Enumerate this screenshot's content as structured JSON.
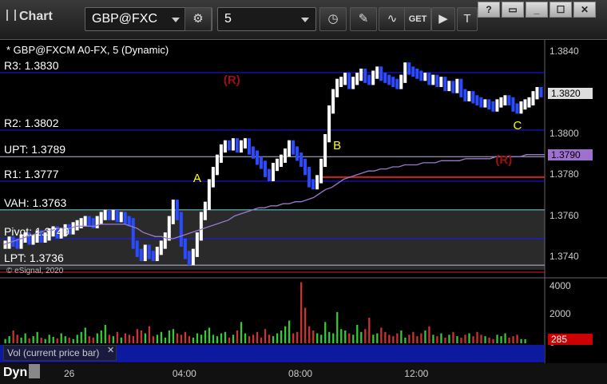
{
  "toolbar": {
    "title": "Chart",
    "symbol": "GBP@FXC",
    "interval": "5",
    "window_controls": [
      "?",
      "▭",
      "_",
      "☐",
      "✕"
    ]
  },
  "legend": "* GBP@FXCM A0-FX, 5 (Dynamic)",
  "levels": [
    {
      "label": "R3: 1.3830",
      "value": 1.383,
      "color": "#1a1aff"
    },
    {
      "label": "R2: 1.3802",
      "value": 1.3802,
      "color": "#1a1aff"
    },
    {
      "label": "UPT: 1.3789",
      "value": 1.3789,
      "color": "#bbbbdd"
    },
    {
      "label": "R1: 1.3777",
      "value": 1.3777,
      "color": "#1a1aff"
    },
    {
      "label": "VAH: 1.3763",
      "value": 1.3763,
      "color": "#66cccc"
    },
    {
      "label": "Pivot: 1.3749",
      "value": 1.3749,
      "color": "#1a1aff"
    },
    {
      "label": "LPT: 1.3736",
      "value": 1.3736,
      "color": "#bbbbdd"
    }
  ],
  "letters": [
    {
      "text": "A",
      "t": 48,
      "p": 1.3778
    },
    {
      "text": "B",
      "t": 83,
      "p": 1.3794
    },
    {
      "text": "C",
      "t": 128,
      "p": 1.3804
    }
  ],
  "rmarks": [
    {
      "text": "(R)",
      "t": 57,
      "p": 1.3826
    },
    {
      "text": "(R)",
      "t": 125,
      "p": 1.3787
    }
  ],
  "price_tags": [
    {
      "text": "1.3820",
      "value": 1.382,
      "bg": "#dddddd",
      "fg": "#000"
    },
    {
      "text": "1.3790",
      "value": 1.379,
      "bg": "#a070d0",
      "fg": "#000"
    }
  ],
  "vol_tag": {
    "text": "285",
    "bg": "#cc0000",
    "fg": "#fff"
  },
  "watermark": "© eSignal, 2020",
  "vol_label": "Vol (current price bar)",
  "bottom": {
    "dyn": "Dyn",
    "day": "26"
  },
  "chart_data": {
    "type": "line",
    "x_ticks": [
      {
        "label": "04:00",
        "t": 45
      },
      {
        "label": "08:00",
        "t": 74
      },
      {
        "label": "12:00",
        "t": 103
      }
    ],
    "price_axis": {
      "ticks": [
        1.374,
        1.376,
        1.378,
        1.38,
        1.382,
        1.384
      ],
      "ylim": [
        1.3731,
        1.3846
      ]
    },
    "volume_axis": {
      "ticks": [
        0,
        2000,
        4000
      ],
      "ylim": [
        0,
        4500
      ]
    },
    "series": [
      {
        "name": "price",
        "values": [
          1.3746,
          1.3748,
          1.3747,
          1.3746,
          1.3749,
          1.375,
          1.3748,
          1.3749,
          1.3751,
          1.3749,
          1.375,
          1.3752,
          1.3753,
          1.3751,
          1.3752,
          1.3754,
          1.3753,
          1.3755,
          1.3756,
          1.3757,
          1.3758,
          1.3757,
          1.3756,
          1.3758,
          1.376,
          1.3761,
          1.376,
          1.3761,
          1.3759,
          1.376,
          1.3758,
          1.3757,
          1.3746,
          1.3742,
          1.374,
          1.3744,
          1.3741,
          1.374,
          1.3743,
          1.3746,
          1.375,
          1.3758,
          1.3766,
          1.376,
          1.3747,
          1.3741,
          1.3738,
          1.3742,
          1.375,
          1.376,
          1.3765,
          1.3776,
          1.3782,
          1.3788,
          1.3793,
          1.3795,
          1.3794,
          1.3796,
          1.3793,
          1.3795,
          1.3796,
          1.3792,
          1.379,
          1.3787,
          1.3785,
          1.3781,
          1.3779,
          1.3784,
          1.3786,
          1.3788,
          1.3791,
          1.3795,
          1.3792,
          1.3789,
          1.3786,
          1.3782,
          1.3776,
          1.3775,
          1.3778,
          1.3786,
          1.3798,
          1.3812,
          1.382,
          1.3825,
          1.3826,
          1.3828,
          1.3824,
          1.3826,
          1.3828,
          1.383,
          1.3827,
          1.3826,
          1.3829,
          1.3831,
          1.3828,
          1.3827,
          1.3826,
          1.3825,
          1.3824,
          1.3827,
          1.3833,
          1.3831,
          1.383,
          1.3829,
          1.3828,
          1.3828,
          1.3826,
          1.3827,
          1.3825,
          1.3826,
          1.3823,
          1.3824,
          1.3822,
          1.3825,
          1.382,
          1.3818,
          1.3819,
          1.3817,
          1.3816,
          1.3815,
          1.3815,
          1.3814,
          1.3813,
          1.3815,
          1.3816,
          1.3817,
          1.3816,
          1.3813,
          1.3812,
          1.3814,
          1.3815,
          1.3816,
          1.3819,
          1.3821,
          1.382
        ]
      },
      {
        "name": "moving-average",
        "values": [
          1.3746,
          1.3747,
          1.3748,
          1.3749,
          1.375,
          1.3751,
          1.3752,
          1.3753,
          1.3753,
          1.3754,
          1.3754,
          1.3754,
          1.3755,
          1.3755,
          1.3755,
          1.3755,
          1.3756,
          1.3756,
          1.3756,
          1.3756,
          1.3756,
          1.3755,
          1.3754,
          1.3752,
          1.3751,
          1.375,
          1.375,
          1.3749,
          1.3749,
          1.375,
          1.3751,
          1.3752,
          1.3753,
          1.3754,
          1.3755,
          1.3756,
          1.3757,
          1.3758,
          1.376,
          1.3761,
          1.3762,
          1.3763,
          1.3764,
          1.3764,
          1.3765,
          1.3765,
          1.3766,
          1.3766,
          1.3767,
          1.3767,
          1.3768,
          1.3769,
          1.3771,
          1.3773,
          1.3774,
          1.3776,
          1.3778,
          1.3779,
          1.378,
          1.3781,
          1.3782,
          1.3782,
          1.3783,
          1.3783,
          1.3784,
          1.3784,
          1.3785,
          1.3785,
          1.3785,
          1.3786,
          1.3786,
          1.3786,
          1.3787,
          1.3787,
          1.3787,
          1.3787,
          1.3788,
          1.3788,
          1.3788,
          1.3788,
          1.3788,
          1.3789,
          1.3789,
          1.3789,
          1.3789,
          1.3789,
          1.379,
          1.379,
          1.379,
          1.379
        ]
      }
    ],
    "volume": [
      300,
      500,
      900,
      600,
      400,
      700,
      350,
      500,
      800,
      400,
      300,
      600,
      450,
      350,
      700,
      500,
      400,
      300,
      600,
      800,
      1100,
      500,
      400,
      700,
      900,
      1300,
      600,
      500,
      800,
      400,
      700,
      600,
      500,
      1000,
      900,
      700,
      1200,
      500,
      600,
      800,
      400,
      900,
      1000,
      700,
      600,
      800,
      500,
      400,
      700,
      600,
      900,
      1100,
      600,
      500,
      700,
      800,
      400,
      600,
      900,
      1500,
      700,
      500,
      600,
      800,
      400,
      1000,
      600,
      500,
      700,
      900,
      1200,
      1600,
      700,
      800,
      4300,
      2500,
      1200,
      900,
      700,
      600,
      1500,
      800,
      700,
      2200,
      1000,
      900,
      700,
      600,
      1300,
      800,
      1000,
      1800,
      600,
      700,
      1100,
      800,
      600,
      500,
      700,
      900,
      400,
      600,
      800,
      500,
      700,
      900,
      1200,
      600,
      500,
      700,
      400,
      600,
      800,
      500,
      400,
      600,
      700,
      500,
      800,
      600,
      500,
      400,
      300,
      600,
      500,
      700,
      400,
      500,
      600,
      300,
      285
    ]
  }
}
